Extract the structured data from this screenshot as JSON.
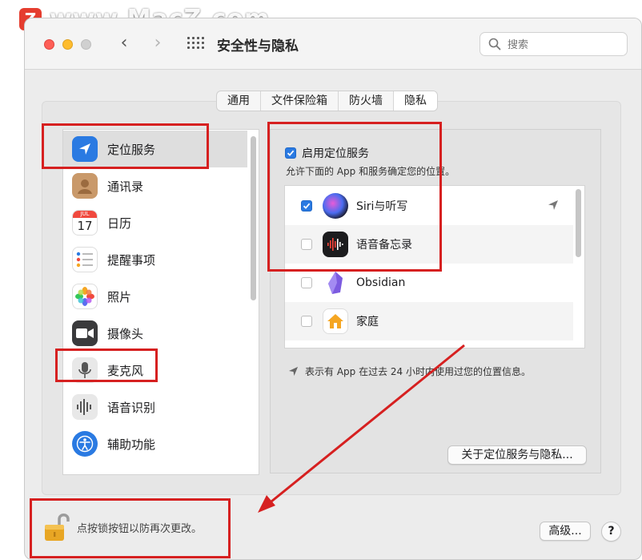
{
  "watermark": {
    "logo_letter": "Z",
    "text": "www.MacZ.com"
  },
  "window": {
    "title": "安全性与隐私",
    "search_placeholder": "搜索"
  },
  "tabs": [
    {
      "label": "通用",
      "active": false
    },
    {
      "label": "文件保险箱",
      "active": false
    },
    {
      "label": "防火墙",
      "active": false
    },
    {
      "label": "隐私",
      "active": true
    }
  ],
  "sidebar": {
    "items": [
      {
        "label": "定位服务",
        "icon": "location-arrow-icon",
        "selected": true
      },
      {
        "label": "通讯录",
        "icon": "contacts-icon"
      },
      {
        "label": "日历",
        "icon": "calendar-icon",
        "icon_month": "JUL",
        "icon_day": "17"
      },
      {
        "label": "提醒事项",
        "icon": "reminders-icon"
      },
      {
        "label": "照片",
        "icon": "photos-icon"
      },
      {
        "label": "摄像头",
        "icon": "camera-icon"
      },
      {
        "label": "麦克风",
        "icon": "microphone-icon"
      },
      {
        "label": "语音识别",
        "icon": "speech-recognition-icon"
      },
      {
        "label": "辅助功能",
        "icon": "accessibility-icon"
      }
    ]
  },
  "location": {
    "enable_label": "启用定位服务",
    "enable_checked": true,
    "description": "允许下面的 App 和服务确定您的位置。",
    "apps": [
      {
        "name": "Siri与听写",
        "checked": true,
        "icon": "siri-icon",
        "recent_use": true
      },
      {
        "name": "语音备忘录",
        "checked": false,
        "icon": "voice-memos-icon",
        "recent_use": false
      },
      {
        "name": "Obsidian",
        "checked": false,
        "icon": "obsidian-icon",
        "recent_use": false
      },
      {
        "name": "家庭",
        "checked": false,
        "icon": "home-icon",
        "recent_use": false
      }
    ],
    "note": "表示有 App 在过去 24 小时内使用过您的位置信息。",
    "about_button": "关于定位服务与隐私..."
  },
  "footer": {
    "lock_label": "点按锁按钮以防再次更改。",
    "advanced_button": "高级...",
    "help_button": "?"
  },
  "colors": {
    "accent": "#2a7ae2",
    "highlight_red": "#d62020"
  }
}
